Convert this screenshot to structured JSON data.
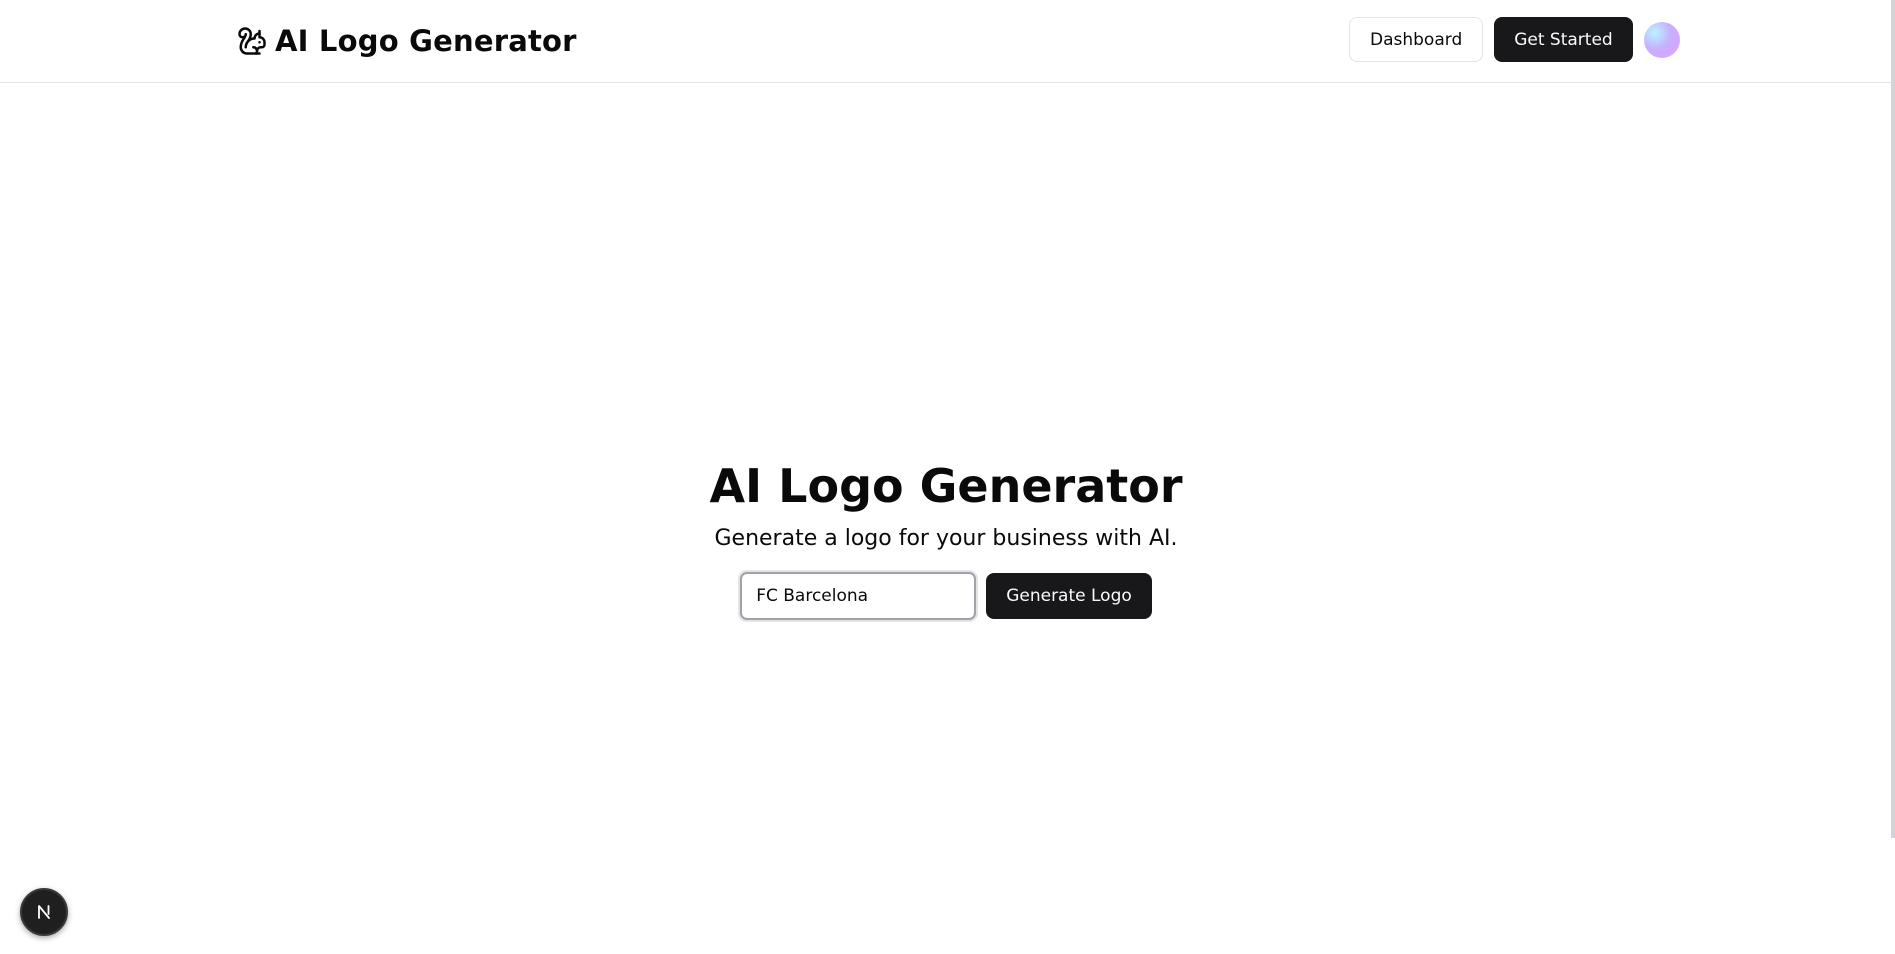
{
  "header": {
    "brand_title": "AI Logo Generator",
    "brand_icon": "squirrel-icon",
    "dashboard_label": "Dashboard",
    "get_started_label": "Get Started",
    "avatar_icon": "user-avatar"
  },
  "hero": {
    "title": "AI Logo Generator",
    "subtitle": "Generate a logo for your business with AI.",
    "input_value": "FC Barcelona",
    "generate_label": "Generate Logo"
  },
  "dev_indicator": {
    "letter": "N",
    "icon": "nextjs-icon"
  },
  "colors": {
    "primary": "#18181b",
    "primary_text": "#fafafa",
    "border": "#e4e4e7",
    "background": "#ffffff"
  }
}
